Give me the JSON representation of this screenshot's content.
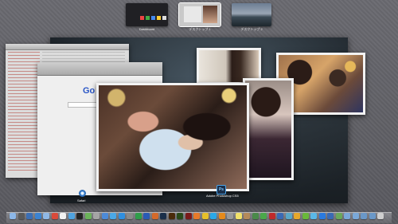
{
  "spaces": [
    {
      "label": "Dashboard"
    },
    {
      "label": "デスクトップ 1"
    },
    {
      "label": "デスクトップ 2"
    }
  ],
  "browser": {
    "logo_text": "Go"
  },
  "apps": {
    "photoshop": {
      "icon_text": "Ps",
      "label": "Adobe Photoshop CS5"
    },
    "safari": {
      "label": "Safari"
    }
  },
  "dock": {
    "icons": [
      "finder-icon",
      "dashboard-icon",
      "mission-control-icon",
      "safari-icon",
      "mail-icon",
      "ical-icon",
      "textedit-icon",
      "ichat-icon",
      "terminal-icon",
      "activity-monitor-icon",
      "preview-icon",
      "iphoto-icon",
      "itunes-icon",
      "app-store-icon",
      "system-preferences-icon",
      "excel-icon",
      "word-icon",
      "powerpoint-icon",
      "photoshop-icon",
      "illustrator-icon",
      "dreamweaver-icon",
      "flash-icon",
      "firefox-icon",
      "chrome-icon",
      "skype-icon",
      "vlc-icon",
      "calculator-icon",
      "stickies-icon",
      "address-book-icon",
      "time-machine-icon",
      "facetime-icon",
      "photo-booth-icon",
      "xcode-icon",
      "coda-icon",
      "transmit-icon",
      "evernote-icon",
      "twitter-icon",
      "dropbox-icon",
      "1password-icon",
      "growl-icon",
      "folder-icon",
      "folder-icon",
      "documents-icon",
      "downloads-icon",
      "trash-icon"
    ]
  },
  "colors": {
    "desktop": "#5d5d63",
    "photoshop_accent": "#4aa3e8"
  }
}
